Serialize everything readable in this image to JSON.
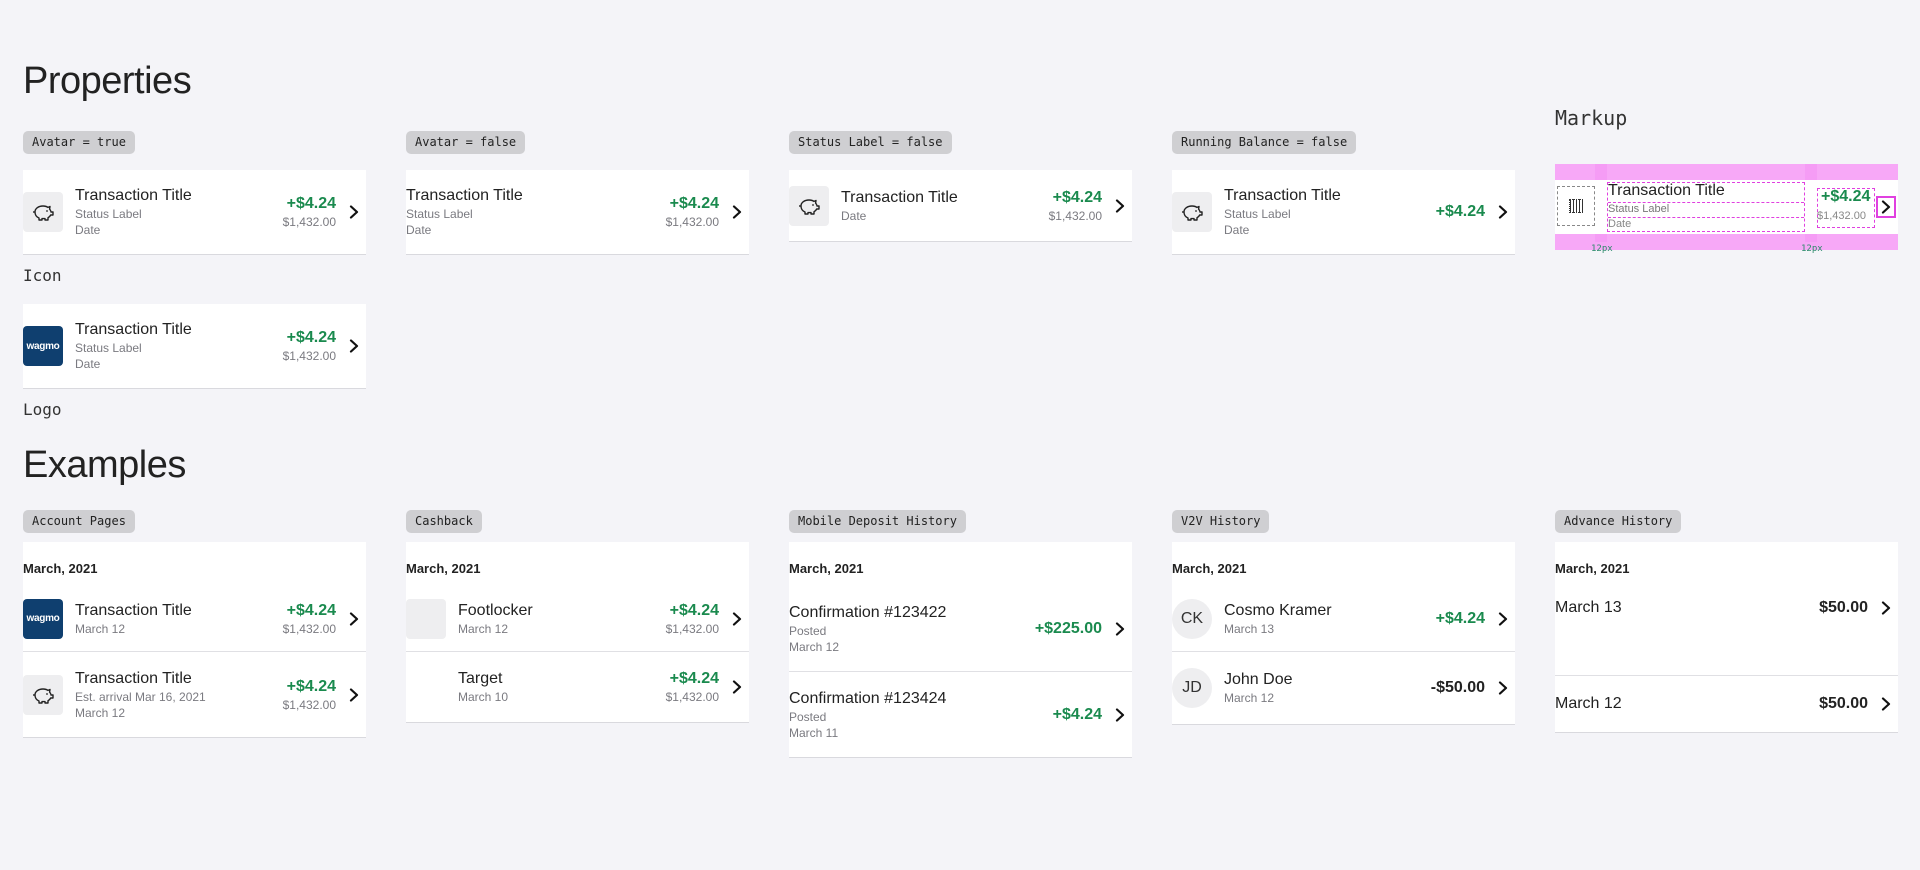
{
  "colors": {
    "positive": "#1a8a4e",
    "logo_bg": "#0f3f6f",
    "pill_bg": "#cfcfd2",
    "markup_accent": "#f28ff2"
  },
  "sections": {
    "properties": "Properties",
    "examples": "Examples",
    "markup": "Markup"
  },
  "labels": {
    "icon": "Icon",
    "logo": "Logo"
  },
  "props": [
    {
      "pill": "Avatar = true",
      "title": "Transaction Title",
      "status": "Status Label",
      "date": "Date",
      "amount": "+$4.24",
      "balance": "$1,432.00",
      "avatar": "piggy-bank-icon"
    },
    {
      "pill": "Avatar = false",
      "title": "Transaction Title",
      "status": "Status Label",
      "date": "Date",
      "amount": "+$4.24",
      "balance": "$1,432.00"
    },
    {
      "pill": "Status Label = false",
      "title": "Transaction Title",
      "date": "Date",
      "amount": "+$4.24",
      "balance": "$1,432.00",
      "avatar": "piggy-bank-icon"
    },
    {
      "pill": "Running Balance = false",
      "title": "Transaction Title",
      "status": "Status Label",
      "date": "Date",
      "amount": "+$4.24",
      "avatar": "piggy-bank-icon"
    }
  ],
  "logo_row": {
    "title": "Transaction Title",
    "status": "Status Label",
    "date": "Date",
    "amount": "+$4.24",
    "balance": "$1,432.00",
    "logo": "wagmo"
  },
  "markup_row": {
    "title": "Transaction Title",
    "status": "Status Label",
    "date": "Date",
    "amount": "+$4.24",
    "balance": "$1,432.00",
    "spacing": "12px"
  },
  "examples": {
    "account": {
      "pill": "Account Pages",
      "month": "March, 2021",
      "rows": [
        {
          "title": "Transaction Title",
          "sub1": "March 12",
          "amount": "+$4.24",
          "balance": "$1,432.00",
          "logo": "wagmo"
        },
        {
          "title": "Transaction Title",
          "sub1": "Est. arrival Mar 16, 2021",
          "sub2": "March 12",
          "amount": "+$4.24",
          "balance": "$1,432.00"
        }
      ]
    },
    "cashback": {
      "pill": "Cashback",
      "month": "March, 2021",
      "rows": [
        {
          "title": "Footlocker",
          "sub1": "March 12",
          "amount": "+$4.24",
          "balance": "$1,432.00"
        },
        {
          "title": "Target",
          "sub1": "March 10",
          "amount": "+$4.24",
          "balance": "$1,432.00"
        }
      ]
    },
    "deposit": {
      "pill": "Mobile Deposit History",
      "month": "March, 2021",
      "rows": [
        {
          "title": "Confirmation #123422",
          "sub1": "Posted",
          "sub2": "March 12",
          "amount": "+$225.00"
        },
        {
          "title": "Confirmation #123424",
          "sub1": "Posted",
          "sub2": "March 11",
          "amount": "+$4.24"
        }
      ]
    },
    "v2v": {
      "pill": "V2V History",
      "month": "March, 2021",
      "rows": [
        {
          "initials": "CK",
          "title": "Cosmo Kramer",
          "sub1": "March 13",
          "amount": "+$4.24"
        },
        {
          "initials": "JD",
          "title": "John Doe",
          "sub1": "March 12",
          "amount": "-$50.00"
        }
      ]
    },
    "advance": {
      "pill": "Advance History",
      "month": "March, 2021",
      "rows": [
        {
          "title": "March 13",
          "amount": "$50.00"
        },
        {
          "title": "March 12",
          "amount": "$50.00"
        }
      ]
    }
  }
}
